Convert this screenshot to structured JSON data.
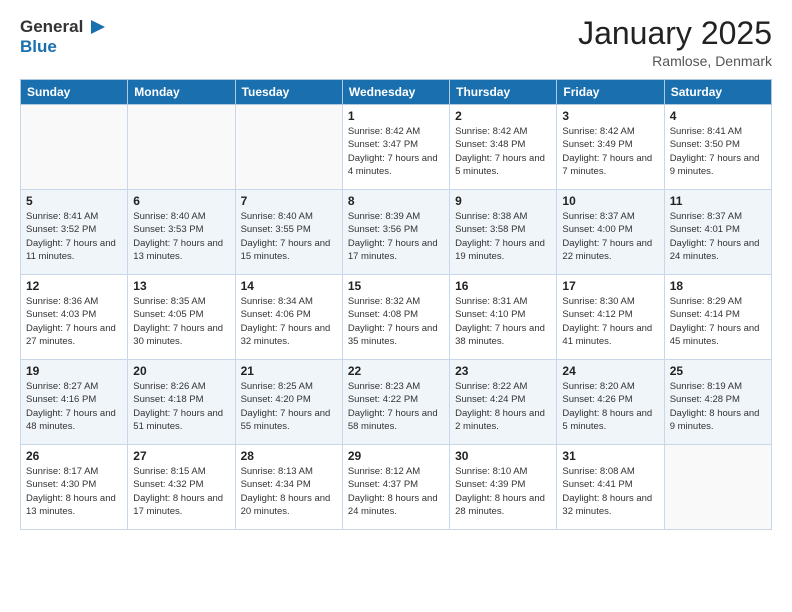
{
  "header": {
    "logo_general": "General",
    "logo_blue": "Blue",
    "month_title": "January 2025",
    "location": "Ramlose, Denmark"
  },
  "days_of_week": [
    "Sunday",
    "Monday",
    "Tuesday",
    "Wednesday",
    "Thursday",
    "Friday",
    "Saturday"
  ],
  "weeks": [
    [
      {
        "day": "",
        "content": ""
      },
      {
        "day": "",
        "content": ""
      },
      {
        "day": "",
        "content": ""
      },
      {
        "day": "1",
        "content": "Sunrise: 8:42 AM\nSunset: 3:47 PM\nDaylight: 7 hours\nand 4 minutes."
      },
      {
        "day": "2",
        "content": "Sunrise: 8:42 AM\nSunset: 3:48 PM\nDaylight: 7 hours\nand 5 minutes."
      },
      {
        "day": "3",
        "content": "Sunrise: 8:42 AM\nSunset: 3:49 PM\nDaylight: 7 hours\nand 7 minutes."
      },
      {
        "day": "4",
        "content": "Sunrise: 8:41 AM\nSunset: 3:50 PM\nDaylight: 7 hours\nand 9 minutes."
      }
    ],
    [
      {
        "day": "5",
        "content": "Sunrise: 8:41 AM\nSunset: 3:52 PM\nDaylight: 7 hours\nand 11 minutes."
      },
      {
        "day": "6",
        "content": "Sunrise: 8:40 AM\nSunset: 3:53 PM\nDaylight: 7 hours\nand 13 minutes."
      },
      {
        "day": "7",
        "content": "Sunrise: 8:40 AM\nSunset: 3:55 PM\nDaylight: 7 hours\nand 15 minutes."
      },
      {
        "day": "8",
        "content": "Sunrise: 8:39 AM\nSunset: 3:56 PM\nDaylight: 7 hours\nand 17 minutes."
      },
      {
        "day": "9",
        "content": "Sunrise: 8:38 AM\nSunset: 3:58 PM\nDaylight: 7 hours\nand 19 minutes."
      },
      {
        "day": "10",
        "content": "Sunrise: 8:37 AM\nSunset: 4:00 PM\nDaylight: 7 hours\nand 22 minutes."
      },
      {
        "day": "11",
        "content": "Sunrise: 8:37 AM\nSunset: 4:01 PM\nDaylight: 7 hours\nand 24 minutes."
      }
    ],
    [
      {
        "day": "12",
        "content": "Sunrise: 8:36 AM\nSunset: 4:03 PM\nDaylight: 7 hours\nand 27 minutes."
      },
      {
        "day": "13",
        "content": "Sunrise: 8:35 AM\nSunset: 4:05 PM\nDaylight: 7 hours\nand 30 minutes."
      },
      {
        "day": "14",
        "content": "Sunrise: 8:34 AM\nSunset: 4:06 PM\nDaylight: 7 hours\nand 32 minutes."
      },
      {
        "day": "15",
        "content": "Sunrise: 8:32 AM\nSunset: 4:08 PM\nDaylight: 7 hours\nand 35 minutes."
      },
      {
        "day": "16",
        "content": "Sunrise: 8:31 AM\nSunset: 4:10 PM\nDaylight: 7 hours\nand 38 minutes."
      },
      {
        "day": "17",
        "content": "Sunrise: 8:30 AM\nSunset: 4:12 PM\nDaylight: 7 hours\nand 41 minutes."
      },
      {
        "day": "18",
        "content": "Sunrise: 8:29 AM\nSunset: 4:14 PM\nDaylight: 7 hours\nand 45 minutes."
      }
    ],
    [
      {
        "day": "19",
        "content": "Sunrise: 8:27 AM\nSunset: 4:16 PM\nDaylight: 7 hours\nand 48 minutes."
      },
      {
        "day": "20",
        "content": "Sunrise: 8:26 AM\nSunset: 4:18 PM\nDaylight: 7 hours\nand 51 minutes."
      },
      {
        "day": "21",
        "content": "Sunrise: 8:25 AM\nSunset: 4:20 PM\nDaylight: 7 hours\nand 55 minutes."
      },
      {
        "day": "22",
        "content": "Sunrise: 8:23 AM\nSunset: 4:22 PM\nDaylight: 7 hours\nand 58 minutes."
      },
      {
        "day": "23",
        "content": "Sunrise: 8:22 AM\nSunset: 4:24 PM\nDaylight: 8 hours\nand 2 minutes."
      },
      {
        "day": "24",
        "content": "Sunrise: 8:20 AM\nSunset: 4:26 PM\nDaylight: 8 hours\nand 5 minutes."
      },
      {
        "day": "25",
        "content": "Sunrise: 8:19 AM\nSunset: 4:28 PM\nDaylight: 8 hours\nand 9 minutes."
      }
    ],
    [
      {
        "day": "26",
        "content": "Sunrise: 8:17 AM\nSunset: 4:30 PM\nDaylight: 8 hours\nand 13 minutes."
      },
      {
        "day": "27",
        "content": "Sunrise: 8:15 AM\nSunset: 4:32 PM\nDaylight: 8 hours\nand 17 minutes."
      },
      {
        "day": "28",
        "content": "Sunrise: 8:13 AM\nSunset: 4:34 PM\nDaylight: 8 hours\nand 20 minutes."
      },
      {
        "day": "29",
        "content": "Sunrise: 8:12 AM\nSunset: 4:37 PM\nDaylight: 8 hours\nand 24 minutes."
      },
      {
        "day": "30",
        "content": "Sunrise: 8:10 AM\nSunset: 4:39 PM\nDaylight: 8 hours\nand 28 minutes."
      },
      {
        "day": "31",
        "content": "Sunrise: 8:08 AM\nSunset: 4:41 PM\nDaylight: 8 hours\nand 32 minutes."
      },
      {
        "day": "",
        "content": ""
      }
    ]
  ]
}
